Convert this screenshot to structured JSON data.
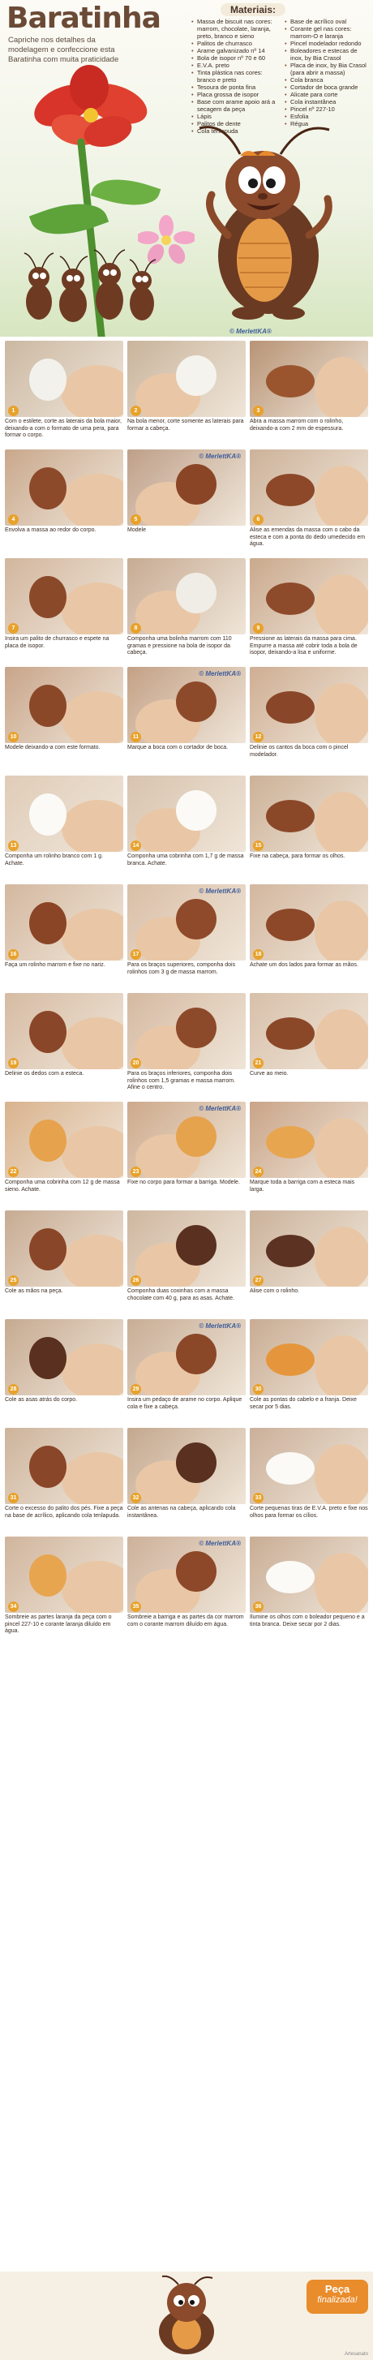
{
  "header": {
    "title": "Baratinha",
    "intro": "Capriche nos detalhes da modelagem e confeccione esta Baratinha com muita praticidade",
    "materials_title": "Materiais:",
    "materials_left": [
      "Massa de biscuit nas cores: marrom, chocolate, laranja, preto, branco e sieno",
      "Palitos de churrasco",
      "Arame galvanizado nº 14",
      "Bola de isopor nº 70 e 60",
      "E.V.A. preto",
      "Tinta plástica nas cores: branco e preto",
      "Tesoura de ponta fina",
      "Placa grossa de isopor",
      "Base com arame apoio ará a secagem da peça",
      "Lápis",
      "Palitos de dente",
      "Cola tenlapuda"
    ],
    "materials_right": [
      "Base de acrílico oval",
      "Corante gel nas cores: marrom-O e laranja",
      "Pincel modelador redondo",
      "Boleadores e estecas de inox, by Bia Crasol",
      "Placa de inox, by Bia Crasol (para abrir a massa)",
      "Cola branca",
      "Cortador de boca grande",
      "Alicate para corte",
      "Cola instantânea",
      "Pincel nº 227-10",
      "Esfolia",
      "Régua"
    ],
    "copyright": "© MerlettKA®"
  },
  "colors": {
    "title": "#6b4a36",
    "badge": "#e8a22a",
    "dough_brown": "#8a4b2c",
    "dough_chocolate": "#5a3020",
    "skin": "#e9c7a6",
    "ready_tag": "#e98c2b"
  },
  "watermark": "© MerlettKA®",
  "steps": [
    {
      "n": "1",
      "caption": "Com o estilete, corte as laterais da bola maior, deixando-a com o formato de uma pera, para formar o corpo.",
      "bg": "#cbb8a2",
      "obj": "#f3f1ec"
    },
    {
      "n": "2",
      "caption": "Na bola menor, corte somente as laterais para formar a cabeça.",
      "bg": "#c9b49c",
      "obj": "#f5f3ee"
    },
    {
      "n": "3",
      "caption": "Abra a massa marrom com o rolinho, deixando-a com 2 mm de espessura.",
      "bg": "#b89476",
      "obj": "#9a552f"
    },
    {
      "n": "4",
      "caption": "Envolva a massa ao redor do corpo.",
      "bg": "#c9a88c",
      "obj": "#8d4a2b"
    },
    {
      "n": "5",
      "caption": "Modele",
      "bg": "#bfa089",
      "obj": "#8a4527"
    },
    {
      "n": "6",
      "caption": "Alise as emendas da massa com o cabo da esteca e com a ponta do dedo umedecido em água.",
      "bg": "#cdb29a",
      "obj": "#8c4828"
    },
    {
      "n": "7",
      "caption": "Insira um palito de churrasco e espete na placa de isopor.",
      "bg": "#d2b69e",
      "obj": "#8a4a2a"
    },
    {
      "n": "8",
      "caption": "Componha uma bolinha marrom com 110 gramas e pressione na bola de isopor da cabeça.",
      "bg": "#c7ab93",
      "obj": "#f0ede6"
    },
    {
      "n": "9",
      "caption": "Pressione as laterais da massa para cima. Empurre a massa até cobrir toda a bola de isopor, deixando-a lisa e uniforme.",
      "bg": "#caa98d",
      "obj": "#8e4b2b"
    },
    {
      "n": "10",
      "caption": "Modele deixando-a com este formato.",
      "bg": "#c8a58a",
      "obj": "#8b4829"
    },
    {
      "n": "11",
      "caption": "Marque a boca com o cortador de boca.",
      "bg": "#c4a186",
      "obj": "#8d4a2a"
    },
    {
      "n": "12",
      "caption": "Delinie os cantos da boca com o pincel modelador.",
      "bg": "#cfae93",
      "obj": "#8a4628"
    },
    {
      "n": "13",
      "caption": "Componha um rolinho branco com 1 g. Achate.",
      "bg": "#e0ccb8",
      "obj": "#fbfaf6"
    },
    {
      "n": "14",
      "caption": "Componha uma cobrinha com 1,7 g de massa branca. Achate.",
      "bg": "#d8c3ae",
      "obj": "#fbfaf6"
    },
    {
      "n": "15",
      "caption": "Fixe na cabeça, para formar os olhos.",
      "bg": "#ccb197",
      "obj": "#8b4829"
    },
    {
      "n": "16",
      "caption": "Faça um rolinho marrom e fixe no nariz.",
      "bg": "#d4b8a0",
      "obj": "#8a4527"
    },
    {
      "n": "17",
      "caption": "Para os braços superiores, componha dois rolinhos com 3 g de massa marrom.",
      "bg": "#d9bea6",
      "obj": "#8e4a2a"
    },
    {
      "n": "18",
      "caption": "Achate um dos lados para formar as mãos.",
      "bg": "#d3b79f",
      "obj": "#8c4829"
    },
    {
      "n": "19",
      "caption": "Delinie os dedos com a esteca.",
      "bg": "#d6bba3",
      "obj": "#8a4628"
    },
    {
      "n": "20",
      "caption": "Para os braços inferiores, componha dois rolinhos com 1,5 gramas e massa marrom. Afine o centro.",
      "bg": "#d5b9a1",
      "obj": "#8d4a2a"
    },
    {
      "n": "21",
      "caption": "Curve ao meio.",
      "bg": "#d8c0aa",
      "obj": "#8b4829"
    },
    {
      "n": "22",
      "caption": "Componha uma cobrinha com 12 g de massa sieno. Achate.",
      "bg": "#d9b38e",
      "obj": "#e6a24c"
    },
    {
      "n": "23",
      "caption": "Fixe no corpo para formar a barriga. Modele.",
      "bg": "#cda98b",
      "obj": "#e5a34e"
    },
    {
      "n": "24",
      "caption": "Marque toda a barriga com a esteca mais larga.",
      "bg": "#c9a488",
      "obj": "#e7a550"
    },
    {
      "n": "25",
      "caption": "Cole as mãos na peça.",
      "bg": "#c7ab93",
      "obj": "#8a4628"
    },
    {
      "n": "26",
      "caption": "Componha duas coxinhas com a massa chocolate com 40 g, para as asas. Achate.",
      "bg": "#cfb7a0",
      "obj": "#5a3020"
    },
    {
      "n": "27",
      "caption": "Alise com o rolinho.",
      "bg": "#cbb29b",
      "obj": "#5c3222"
    },
    {
      "n": "28",
      "caption": "Cole as asas atrás do corpo.",
      "bg": "#c6aa91",
      "obj": "#5a3020"
    },
    {
      "n": "29",
      "caption": "Insira um pedaço de arame no corpo. Aplique cola e fixe a cabeça.",
      "bg": "#c8ad95",
      "obj": "#8b4829"
    },
    {
      "n": "30",
      "caption": "Cole as pontas do cabelo e a franja. Deixe secar por 5 dias.",
      "bg": "#c9ac93",
      "obj": "#e5963c"
    },
    {
      "n": "31",
      "caption": "Corte o excesso do palito dos pés. Fixe a peça na base de acrílico, aplicando cola tenlapuda.",
      "bg": "#cdb49c",
      "obj": "#8a4628"
    },
    {
      "n": "32",
      "caption": "Cole as antenas na cabeça, aplicando cola instantânea.",
      "bg": "#c4a88f",
      "obj": "#5a3020"
    },
    {
      "n": "33",
      "caption": "Corte pequenas tiras de E.V.A. preto e fixe nos olhos para formar os cílios.",
      "bg": "#cbb09a",
      "obj": "#fbfaf6"
    },
    {
      "n": "34",
      "caption": "Sombreie as partes laranja da peça com o pincel 227-10 e corante laranja diluído em água.",
      "bg": "#d0b59d",
      "obj": "#e7a550"
    },
    {
      "n": "35",
      "caption": "Sombreie a barriga e as partes da cor marrom com o corante marrom diluído em água.",
      "bg": "#cdb19a",
      "obj": "#8c4829"
    },
    {
      "n": "36",
      "caption": "Ilumine os olhos com o boleador pequeno e a tinta branca. Deixe secar por 2 dias.",
      "bg": "#c9ad95",
      "obj": "#fbfaf6"
    }
  ],
  "footer": {
    "ready_line1": "Peça",
    "ready_line2": "finalizada!",
    "source": "Artesanato"
  }
}
